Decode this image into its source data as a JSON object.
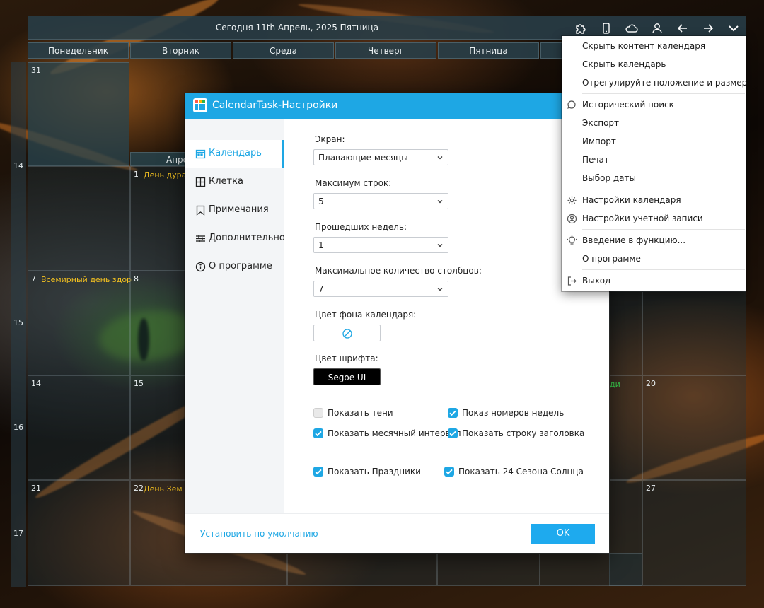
{
  "header": {
    "title": "Сегодня 11th Апрель, 2025 Пятница",
    "toolbar_icons": [
      "puzzle-icon",
      "phone-icon",
      "cloud-icon",
      "user-icon",
      "arrow-left-icon",
      "arrow-right-icon",
      "chevron-down-icon"
    ]
  },
  "calendar": {
    "weekdays": [
      "Понедельник",
      "Вторник",
      "Среда",
      "Четверг",
      "Пятница"
    ],
    "week_numbers": [
      "14",
      "15",
      "16",
      "17"
    ],
    "cells": {
      "c31": "31",
      "month_label": "Апре",
      "c1": "1",
      "c1_event": "День дурак",
      "c7": "7",
      "c7_event": "Всемирный день здор",
      "c8": "8",
      "c14": "14",
      "c15": "15",
      "c20": "20",
      "c20_event": "ди",
      "c21": "21",
      "c22": "22",
      "c22_event": "День Зем",
      "c27": "27"
    },
    "event_color": "#f2c020",
    "event_color_alt": "#3ccf4e"
  },
  "dialog": {
    "title": "CalendarTask-Настройки",
    "nav": [
      {
        "label": "Календарь",
        "icon": "calendar-icon"
      },
      {
        "label": "Клетка",
        "icon": "grid-icon"
      },
      {
        "label": "Примечания",
        "icon": "bookmark-icon"
      },
      {
        "label": "Дополнительно",
        "icon": "sliders-icon"
      },
      {
        "label": "О программе",
        "icon": "info-icon"
      }
    ],
    "fields": {
      "screen_label": "Экран:",
      "screen_value": "Плавающие месяцы",
      "max_rows_label": "Максимум строк:",
      "max_rows_value": "5",
      "past_weeks_label": "Прошедших недель:",
      "past_weeks_value": "1",
      "max_cols_label": "Максимальное количество столбцов:",
      "max_cols_value": "7",
      "bg_color_label": "Цвет фона календаря:",
      "font_color_label": "Цвет шрифта:",
      "font_value": "Segoe UI"
    },
    "checkboxes": {
      "show_shadows": {
        "label": "Показать тени",
        "checked": false
      },
      "show_week_numbers": {
        "label": "Показ номеров недель",
        "checked": true
      },
      "show_month_interval": {
        "label": "Показать месячный интервал",
        "checked": true
      },
      "show_title_bar": {
        "label": "Показать строку заголовка",
        "checked": true
      },
      "show_holidays": {
        "label": "Показать Праздники",
        "checked": true
      },
      "show_solar_terms": {
        "label": "Показать 24 Сезона Солнца",
        "checked": true
      }
    },
    "reset_link": "Установить по умолчанию",
    "ok_label": "OK",
    "accent": "#1ea7e4"
  },
  "menu": {
    "items": [
      {
        "label": "Скрыть контент календаря"
      },
      {
        "label": "Скрыть календарь"
      },
      {
        "label": "Отрегулируйте положение и размер"
      },
      {
        "label": "Исторический поиск",
        "icon": "search-icon"
      },
      {
        "label": "Экспорт"
      },
      {
        "label": "Импорт"
      },
      {
        "label": "Печат"
      },
      {
        "label": "Выбор даты"
      },
      {
        "label": "Настройки календаря",
        "icon": "gear-icon"
      },
      {
        "label": "Настройки учетной записи",
        "icon": "user-circle-icon"
      },
      {
        "label": "Введение в функцию...",
        "icon": "lightbulb-icon"
      },
      {
        "label": "О программе"
      },
      {
        "label": "Выход",
        "icon": "exit-icon"
      }
    ]
  }
}
